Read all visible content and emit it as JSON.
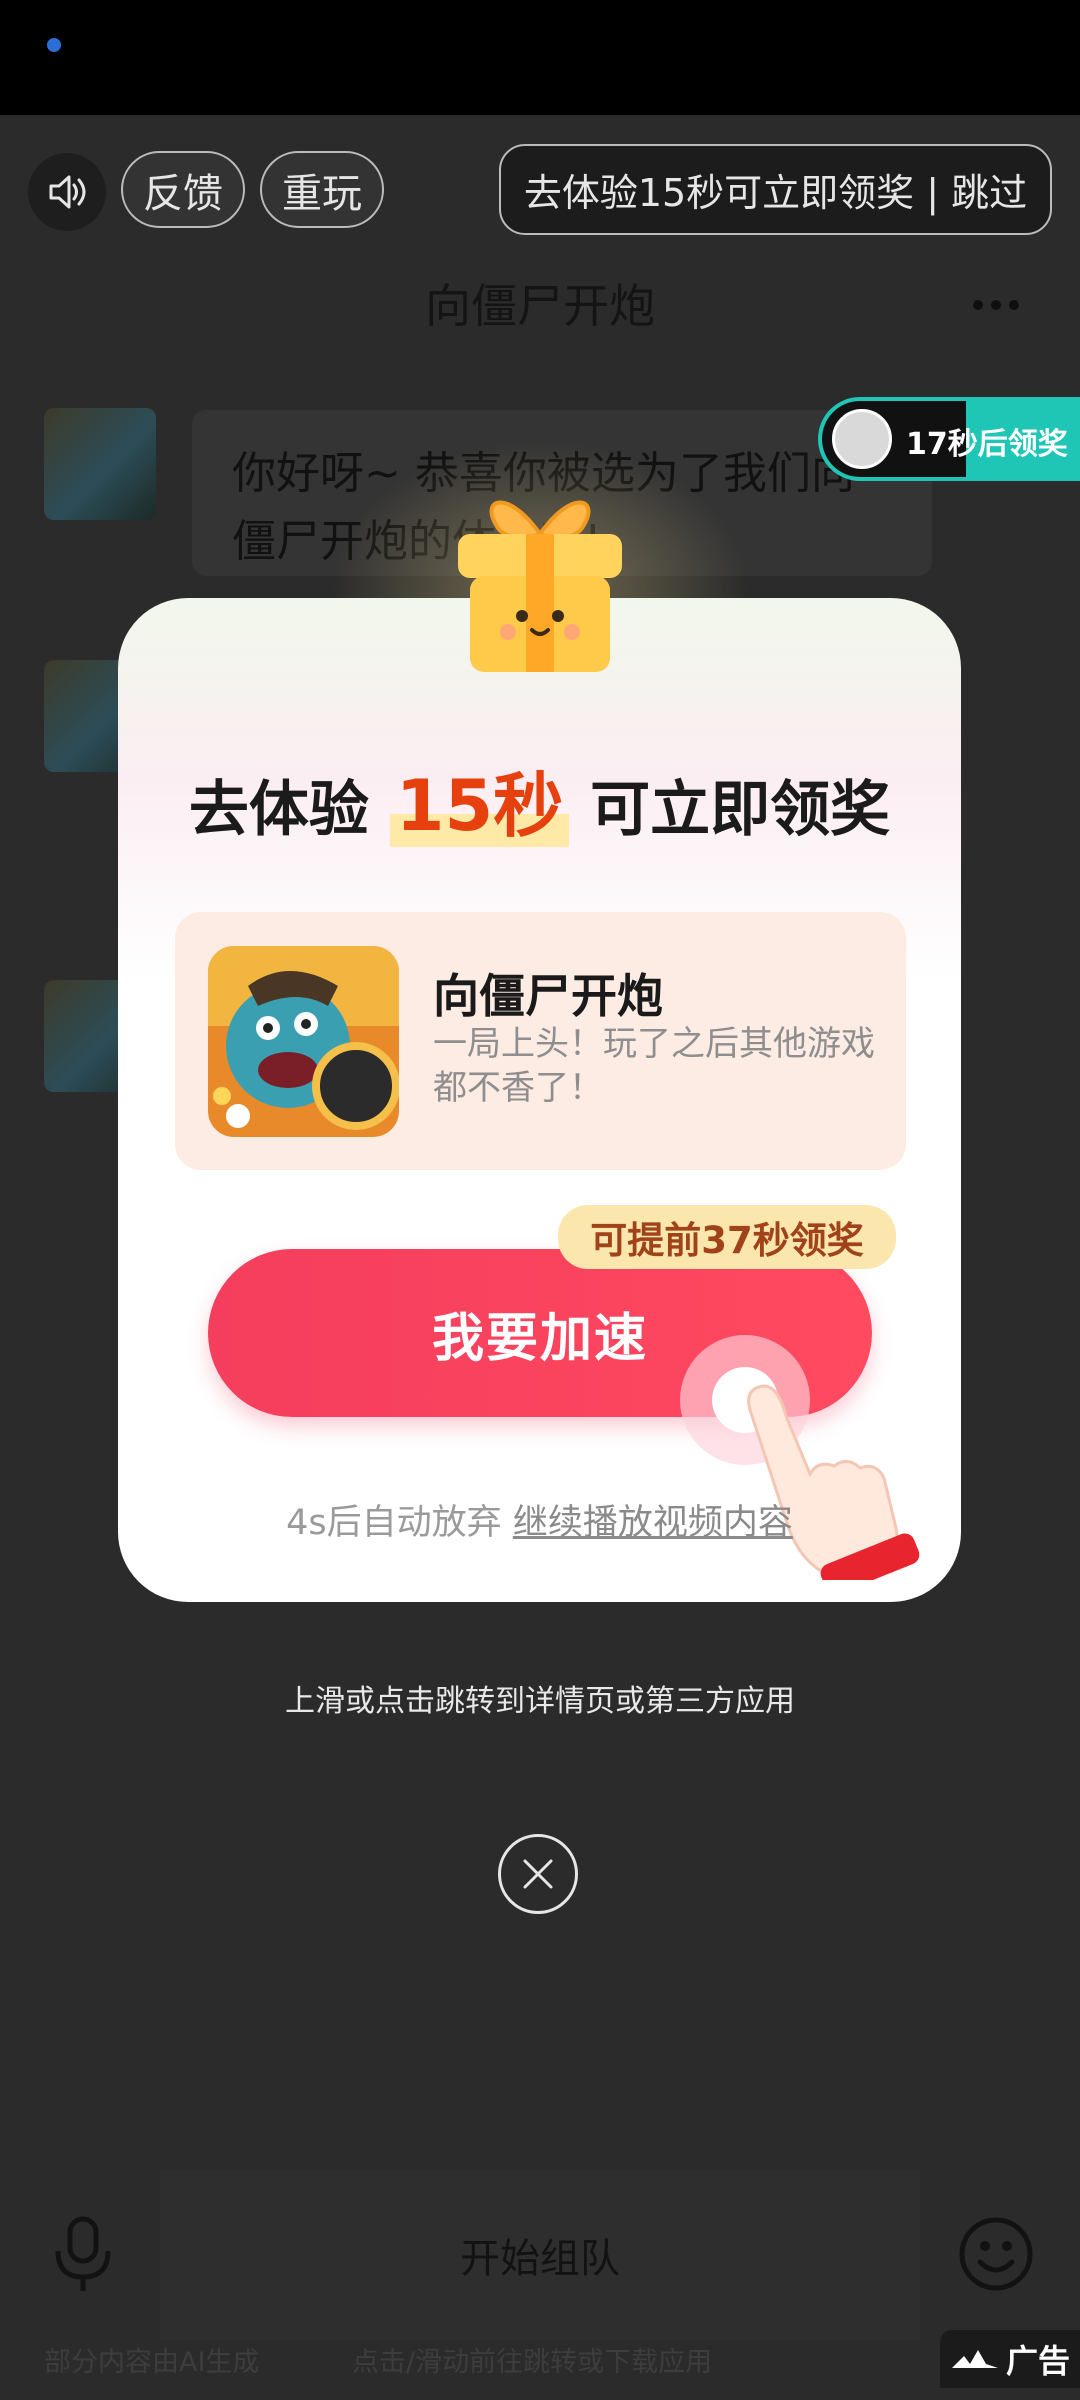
{
  "ad_bar": {
    "feedback": "反馈",
    "replay": "重玩",
    "skip": "去体验15秒可立即领奖 | 跳过"
  },
  "app_page": {
    "title": "向僵尸开炮",
    "bubble_text": "你好呀~ 恭喜你被选为了我们向僵尸开炮的体验官!"
  },
  "reward_chip": {
    "label": "17秒后领奖",
    "color": "#1fc6b6"
  },
  "modal": {
    "heading_prefix": "去体验",
    "heading_highlight": "15秒",
    "heading_suffix": "可立即领奖",
    "app_name": "向僵尸开炮",
    "app_desc": "一局上头！玩了之后其他游戏都不香了！",
    "speed_badge": "可提前37秒领奖",
    "speed_button": "我要加速",
    "auto_prefix": "4s后自动放弃",
    "auto_link": "继续播放视频内容",
    "accent": "#f53d5d"
  },
  "hints": {
    "swipe": "上滑或点击跳转到详情页或第三方应用"
  },
  "bottom": {
    "input_label": "开始组队",
    "footer_ai": "部分内容由AI生成",
    "footer_tap": "点击/滑动前往跳转或下载应用",
    "ad_tag": "广告"
  }
}
